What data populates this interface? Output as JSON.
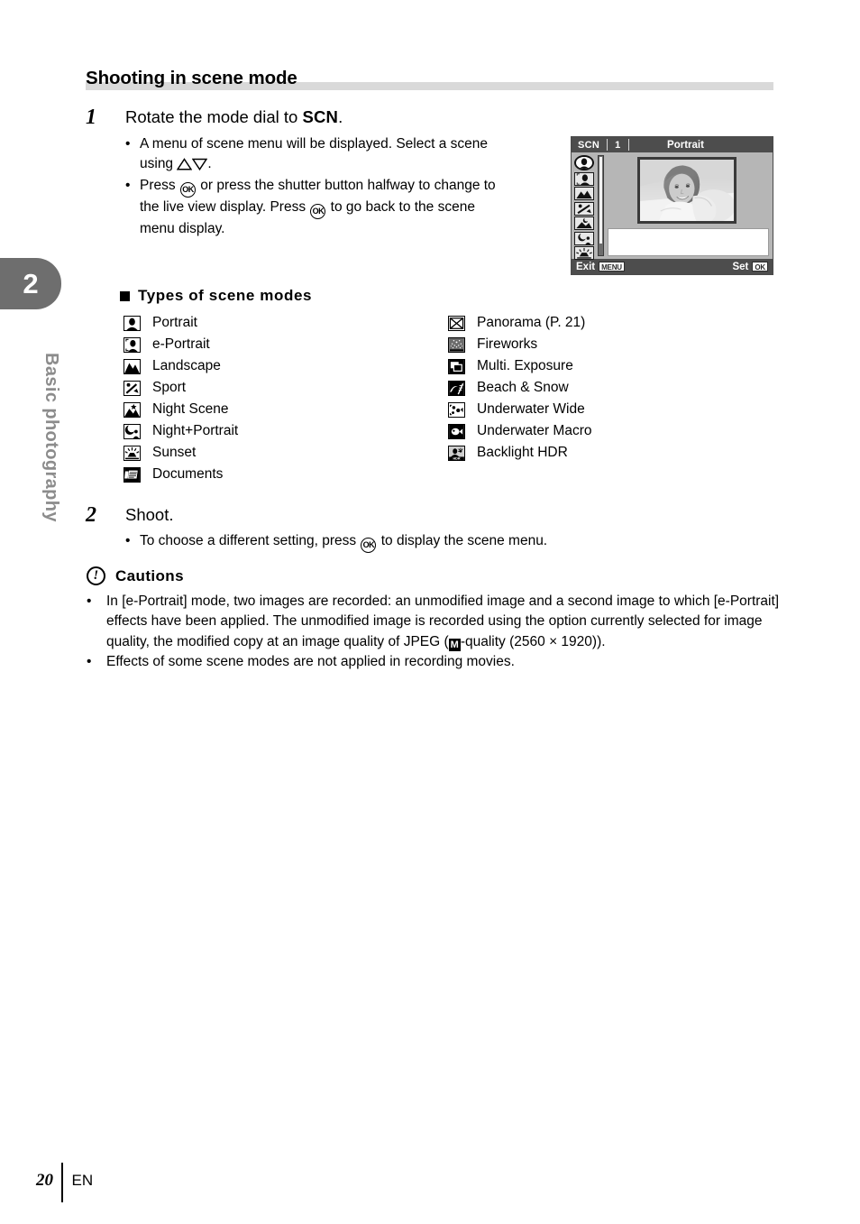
{
  "chapter": {
    "number": "2",
    "name": "Basic photography"
  },
  "heading": {
    "title": "Shooting in scene mode"
  },
  "steps": [
    {
      "number": "1",
      "title_before": "Rotate the mode dial to ",
      "title_bold": "SCN",
      "title_after": ".",
      "bullets": [
        {
          "dot": "•",
          "part1": "A menu of scene menu will be displayed. Select a scene using ",
          "part2": "."
        },
        {
          "dot": "•",
          "part1": "Press ",
          "ok1": "OK",
          "part2": " or press the shutter button halfway to change to the live view display. Press ",
          "ok2": "OK",
          "part3": " to go back to the scene menu display."
        }
      ]
    },
    {
      "number": "2",
      "title": "Shoot.",
      "bullets": [
        {
          "dot": "•",
          "part1": "To choose a different setting, press ",
          "ok1": "OK",
          "part2": " to display the scene menu."
        }
      ]
    }
  ],
  "scene_modes_section": {
    "heading": "Types of scene modes",
    "left_column": [
      {
        "icon": "portrait-icon",
        "label": "Portrait"
      },
      {
        "icon": "e-portrait-icon",
        "label": "e-Portrait"
      },
      {
        "icon": "landscape-icon",
        "label": "Landscape"
      },
      {
        "icon": "sport-icon",
        "label": "Sport"
      },
      {
        "icon": "night-scene-icon",
        "label": "Night Scene"
      },
      {
        "icon": "night-portrait-icon",
        "label": "Night+Portrait"
      },
      {
        "icon": "sunset-icon",
        "label": "Sunset"
      },
      {
        "icon": "documents-icon",
        "label": "Documents"
      }
    ],
    "right_column": [
      {
        "icon": "panorama-icon",
        "label": "Panorama (P. 21)"
      },
      {
        "icon": "fireworks-icon",
        "label": "Fireworks"
      },
      {
        "icon": "multi-exposure-icon",
        "label": "Multi. Exposure"
      },
      {
        "icon": "beach-snow-icon",
        "label": "Beach & Snow"
      },
      {
        "icon": "underwater-wide-icon",
        "label": "Underwater Wide"
      },
      {
        "icon": "underwater-macro-icon",
        "label": "Underwater Macro"
      },
      {
        "icon": "backlight-hdr-icon",
        "label": "Backlight HDR"
      }
    ]
  },
  "cautions": {
    "icon": "exclamation-circle-icon",
    "exclamation": "!",
    "heading": "Cautions",
    "items": [
      {
        "dot": "•",
        "part1": "In [e-Portrait] mode, two images are recorded: an unmodified image and a second image to which [e-Portrait] effects have been applied. The unmodified image is recorded using the option currently selected for image quality, the modified copy at an image quality of JPEG (",
        "badge": "M",
        "part2": "-quality (2560 × 1920))."
      },
      {
        "dot": "•",
        "part1": "Effects of some scene modes are not applied in recording movies."
      }
    ]
  },
  "lcd": {
    "mode_label": "SCN",
    "slot_number": "1",
    "title": "Portrait",
    "exit_label": "Exit",
    "exit_key": "MENU",
    "set_label": "Set",
    "set_key": "OK",
    "strip_icons": [
      "portrait-icon",
      "e-portrait-icon",
      "landscape-icon",
      "sport-icon",
      "night-scene-icon",
      "night-portrait-icon",
      "sunset-icon"
    ]
  },
  "footer": {
    "page_number": "20",
    "language": "EN"
  },
  "colors": {
    "chapter_tab": "#6e6e6e",
    "chapter_name": "#8c8c8c",
    "heading_rule": "#d9d9d9",
    "lcd_bar": "#4d4d4d",
    "lcd_background": "#b6b6b6"
  }
}
